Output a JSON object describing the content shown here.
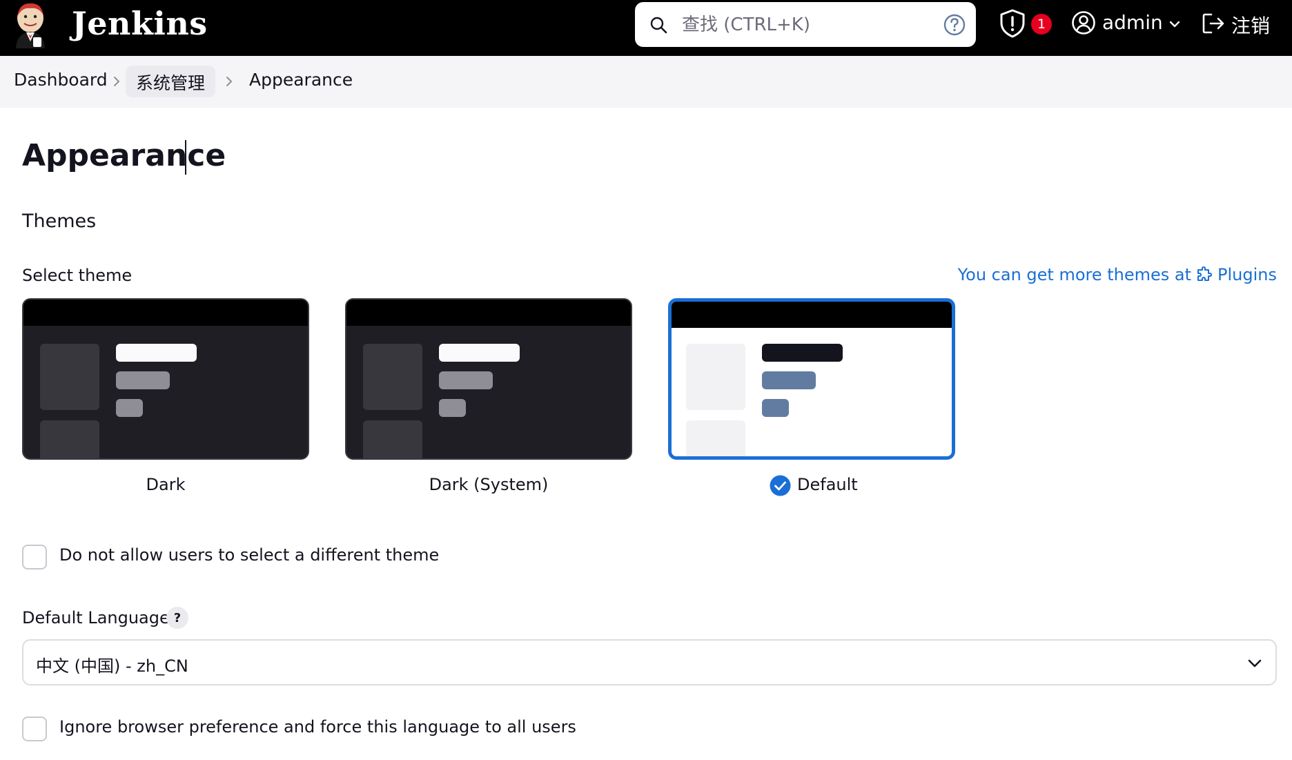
{
  "header": {
    "brand": "Jenkins",
    "search_placeholder": "查找 (CTRL+K)",
    "security_badge": "1",
    "user": "admin",
    "logout": "注销"
  },
  "breadcrumb": [
    "Dashboard",
    "系统管理",
    "Appearance"
  ],
  "page": {
    "title": "Appearance",
    "section": "Themes",
    "select_theme_label": "Select theme",
    "more_themes_text": "You can get more themes at",
    "more_themes_link": "Plugins",
    "themes": [
      {
        "label": "Dark",
        "selected": false
      },
      {
        "label": "Dark (System)",
        "selected": false
      },
      {
        "label": "Default",
        "selected": true
      }
    ],
    "disallow_theme_label": "Do not allow users to select a different theme",
    "default_language_label": "Default Language",
    "help_mark": "?",
    "language_value": "中文 (中国) - zh_CN",
    "force_language_label": "Ignore browser preference and force this language to all users"
  },
  "colors": {
    "header_bg": "#000000",
    "accent": "#1a6fd6",
    "badge": "#e6001f"
  }
}
